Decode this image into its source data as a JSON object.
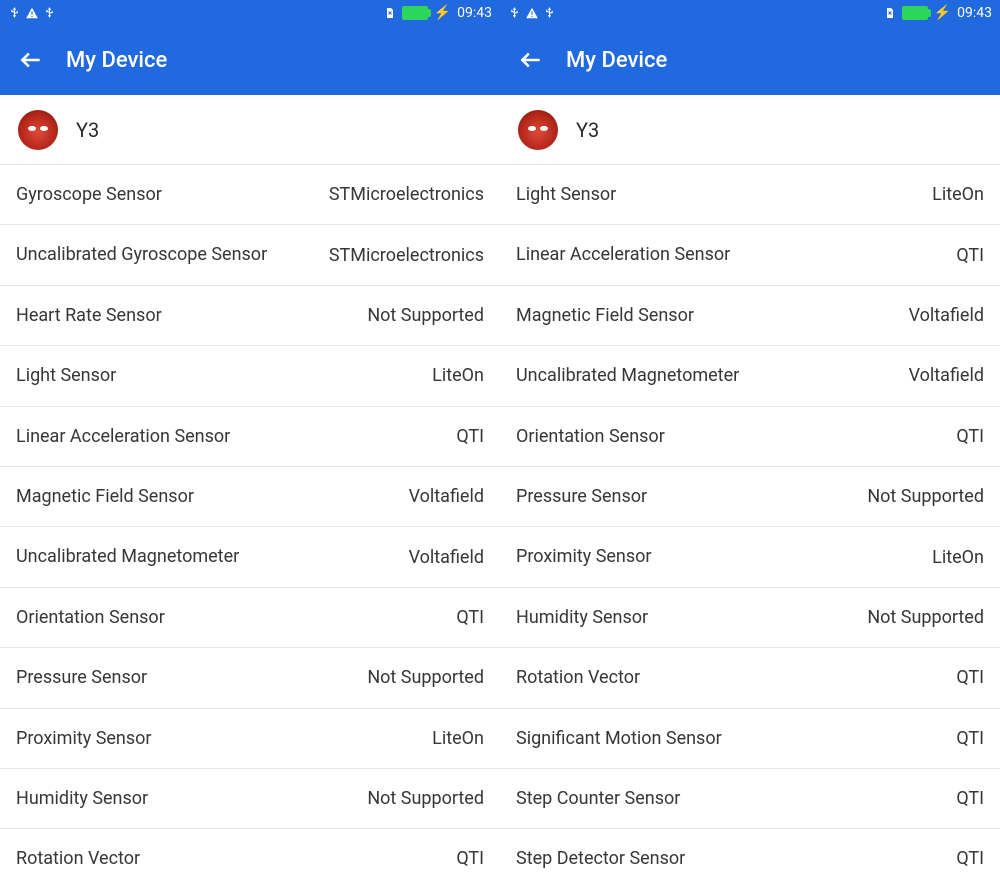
{
  "statusbar": {
    "time": "09:43",
    "charging_glyph": "⚡"
  },
  "appbar": {
    "title": "My Device"
  },
  "device": {
    "name": "Y3"
  },
  "left_list": [
    {
      "label": "Gyroscope Sensor",
      "value": "STMicroelectronics"
    },
    {
      "label": "Uncalibrated Gyroscope Sensor",
      "value": "STMicroelectronics"
    },
    {
      "label": "Heart Rate Sensor",
      "value": "Not Supported"
    },
    {
      "label": "Light Sensor",
      "value": "LiteOn"
    },
    {
      "label": "Linear Acceleration Sensor",
      "value": "QTI"
    },
    {
      "label": "Magnetic Field Sensor",
      "value": "Voltafield"
    },
    {
      "label": "Uncalibrated Magnetometer",
      "value": "Voltafield"
    },
    {
      "label": "Orientation Sensor",
      "value": "QTI"
    },
    {
      "label": "Pressure Sensor",
      "value": "Not Supported"
    },
    {
      "label": "Proximity Sensor",
      "value": "LiteOn"
    },
    {
      "label": "Humidity Sensor",
      "value": "Not Supported"
    },
    {
      "label": "Rotation Vector",
      "value": "QTI"
    }
  ],
  "right_list": [
    {
      "label": "Light Sensor",
      "value": "LiteOn"
    },
    {
      "label": "Linear Acceleration Sensor",
      "value": "QTI"
    },
    {
      "label": "Magnetic Field Sensor",
      "value": "Voltafield"
    },
    {
      "label": "Uncalibrated Magnetometer",
      "value": "Voltafield"
    },
    {
      "label": "Orientation Sensor",
      "value": "QTI"
    },
    {
      "label": "Pressure Sensor",
      "value": "Not Supported"
    },
    {
      "label": "Proximity Sensor",
      "value": "LiteOn"
    },
    {
      "label": "Humidity Sensor",
      "value": "Not Supported"
    },
    {
      "label": "Rotation Vector",
      "value": "QTI"
    },
    {
      "label": "Significant Motion Sensor",
      "value": "QTI"
    },
    {
      "label": "Step Counter Sensor",
      "value": "QTI"
    },
    {
      "label": "Step Detector Sensor",
      "value": "QTI"
    }
  ]
}
